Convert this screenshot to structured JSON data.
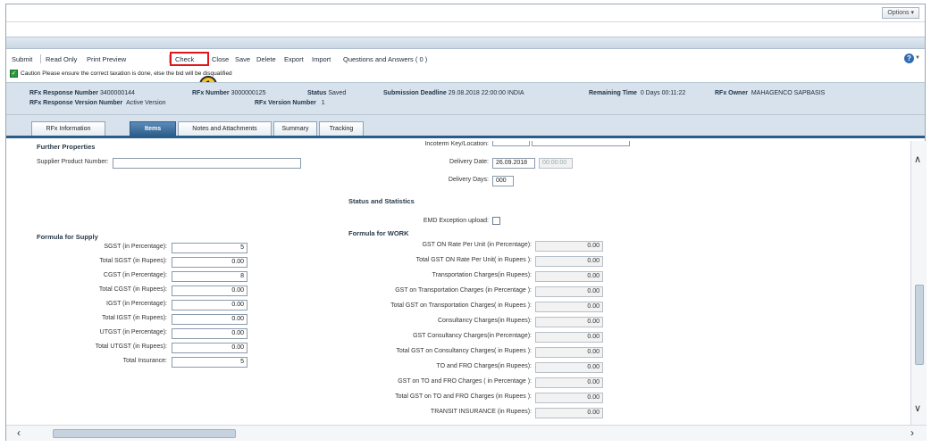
{
  "top": {
    "options_label": "Options ▾"
  },
  "toolbar": {
    "submit": "Submit",
    "read_only": "Read Only",
    "print_preview": "Print Preview",
    "check": "Check",
    "close": "Close",
    "save": "Save",
    "delete": "Delete",
    "export": "Export",
    "import": "Import",
    "qa": "Questions and Answers ( 0 )",
    "help_icon": "help-icon"
  },
  "caution": {
    "text": "Caution  Please ensure the correct taxation is done, else the bid will be disqualified",
    "step_number": "1",
    "accent": "#e0141a"
  },
  "header": {
    "rfx_response_number_label": "RFx Response Number",
    "rfx_response_number": "3400000144",
    "rfx_number_label": "RFx Number",
    "rfx_number": "3000000125",
    "status_label": "Status",
    "status": "Saved",
    "submission_deadline_label": "Submission Deadline",
    "submission_deadline": "29.08.2018 22:00:00 INDIA",
    "remaining_time_label": "Remaining Time",
    "remaining_time": "0 Days 00:11:22",
    "rfx_owner_label": "RFx Owner",
    "rfx_owner": "MAHAGENCO SAPBASIS",
    "rfx_response_version_label": "RFx Response Version Number",
    "rfx_response_version": "Active Version",
    "rfx_version_label": "RFx Version Number",
    "rfx_version": "1"
  },
  "tabs": [
    {
      "label": "RFx Information"
    },
    {
      "label": "Items"
    },
    {
      "label": "Notes and Attachments"
    },
    {
      "label": "Summary"
    },
    {
      "label": "Tracking"
    }
  ],
  "further": {
    "title": "Further Properties",
    "supplier_product_number_label": "Supplier Product Number:",
    "supplier_product_number": "",
    "top_cut_label": "Incoterm Key/Location:",
    "delivery_date_label": "Delivery Date:",
    "delivery_date": "26.09.2018",
    "delivery_time": "00:00:00",
    "delivery_days_label": "Delivery Days:",
    "delivery_days": "000"
  },
  "status_stats": {
    "title": "Status and Statistics",
    "emd_label": "EMD Exception upload:"
  },
  "supply": {
    "title": "Formula for Supply",
    "rows": [
      {
        "label": "SGST (in Percentage):",
        "value": "5"
      },
      {
        "label": "Total SGST (in Rupees):",
        "value": "0.00"
      },
      {
        "label": "CGST (in Percentage):",
        "value": "8"
      },
      {
        "label": "Total CGST (in Rupees):",
        "value": "0.00"
      },
      {
        "label": "IGST (in Percentage):",
        "value": "0.00"
      },
      {
        "label": "Total IGST (in Rupees):",
        "value": "0.00"
      },
      {
        "label": "UTGST (in Percentage):",
        "value": "0.00"
      },
      {
        "label": "Total UTGST (in Rupees):",
        "value": "0.00"
      },
      {
        "label": "Total Insurance:",
        "value": "5"
      }
    ]
  },
  "work": {
    "title": "Formula for WORK",
    "rows": [
      {
        "label": "GST ON Rate Per Unit (in Percentage):",
        "value": "0.00"
      },
      {
        "label": "Total GST ON Rate Per Unit( in Rupees ):",
        "value": "0.00"
      },
      {
        "label": "Transportation Charges(in Rupees):",
        "value": "0.00"
      },
      {
        "label": "GST on Transportation Charges  (in Percentage ):",
        "value": "0.00"
      },
      {
        "label": "Total GST on Transportation Charges( in Rupees ):",
        "value": "0.00"
      },
      {
        "label": "Consultancy Charges(in Rupees):",
        "value": "0.00"
      },
      {
        "label": "GST Consultancy Charges(in Percentage):",
        "value": "0.00"
      },
      {
        "label": "Total GST on Consultancy Charges( in Rupees ):",
        "value": "0.00"
      },
      {
        "label": "TO and FRO Charges(in Rupees):",
        "value": "0.00"
      },
      {
        "label": "GST on TO and FRO Charges  ( in Percentage ):",
        "value": "0.00"
      },
      {
        "label": "Total GST on TO and FRO Charges (in Rupees ):",
        "value": "0.00"
      },
      {
        "label": "TRANSIT INSURANCE (in Rupees):",
        "value": "0.00"
      }
    ]
  }
}
